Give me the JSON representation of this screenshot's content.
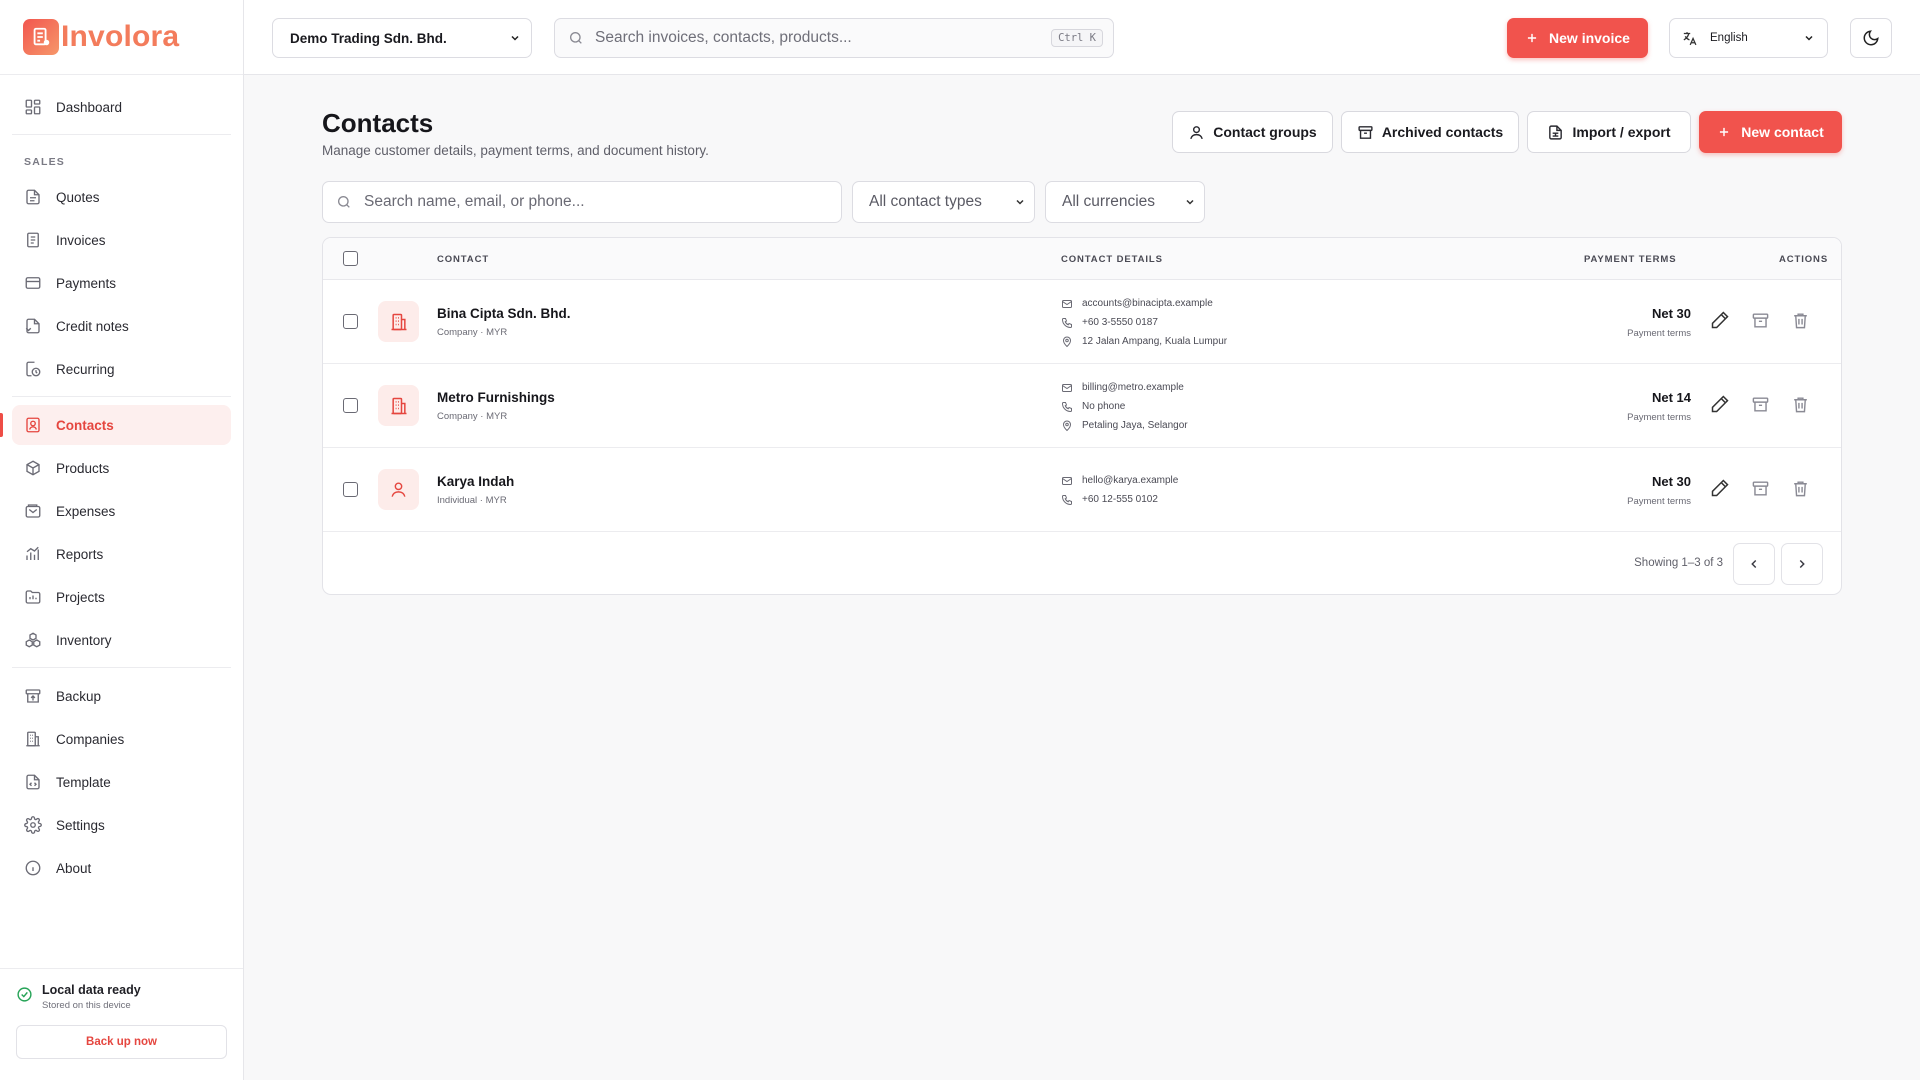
{
  "app": {
    "name": "Involora"
  },
  "sidebar": {
    "dashboard": "Dashboard",
    "section_sales": "SALES",
    "sales_items": [
      "Quotes",
      "Invoices",
      "Payments",
      "Credit notes",
      "Recurring"
    ],
    "mid_items": [
      "Contacts",
      "Products",
      "Expenses",
      "Reports",
      "Projects",
      "Inventory"
    ],
    "bottom_items": [
      "Backup",
      "Companies",
      "Template",
      "Settings",
      "About"
    ],
    "status_title": "Local data ready",
    "status_sub": "Stored on this device",
    "backup_button": "Back up now"
  },
  "topbar": {
    "company": "Demo Trading Sdn. Bhd.",
    "search_placeholder": "Search invoices, contacts, products...",
    "shortcut": "Ctrl K",
    "new_invoice": "New invoice",
    "language": "English"
  },
  "page": {
    "title": "Contacts",
    "subtitle": "Manage customer details, payment terms, and document history.",
    "contact_groups": "Contact groups",
    "archived_contacts": "Archived contacts",
    "import_export": "Import / export",
    "new_contact": "New contact"
  },
  "filters": {
    "search_placeholder": "Search name, email, or phone...",
    "type": "All contact types",
    "currency": "All currencies"
  },
  "table": {
    "headers": {
      "contact": "CONTACT",
      "details": "CONTACT DETAILS",
      "terms": "PAYMENT TERMS",
      "actions": "ACTIONS"
    },
    "rows": [
      {
        "name": "Bina Cipta Sdn. Bhd.",
        "meta": "Company · MYR",
        "email": "accounts@binacipta.example",
        "phone": "+60 3-5550 0187",
        "address": "12 Jalan Ampang, Kuala Lumpur",
        "terms": "Net 30",
        "terms_label": "Payment terms"
      },
      {
        "name": "Metro Furnishings",
        "meta": "Company · MYR",
        "email": "billing@metro.example",
        "phone": "No phone",
        "address": "Petaling Jaya, Selangor",
        "terms": "Net 14",
        "terms_label": "Payment terms"
      },
      {
        "name": "Karya Indah",
        "meta": "Individual · MYR",
        "email": "hello@karya.example",
        "phone": "+60 12-555 0102",
        "terms": "Net 30",
        "terms_label": "Payment terms"
      }
    ],
    "showing": "Showing 1–3 of 3"
  },
  "colors": {
    "accent": "#f1534d",
    "active_bg": "#fdefee",
    "ok": "#26a357"
  }
}
